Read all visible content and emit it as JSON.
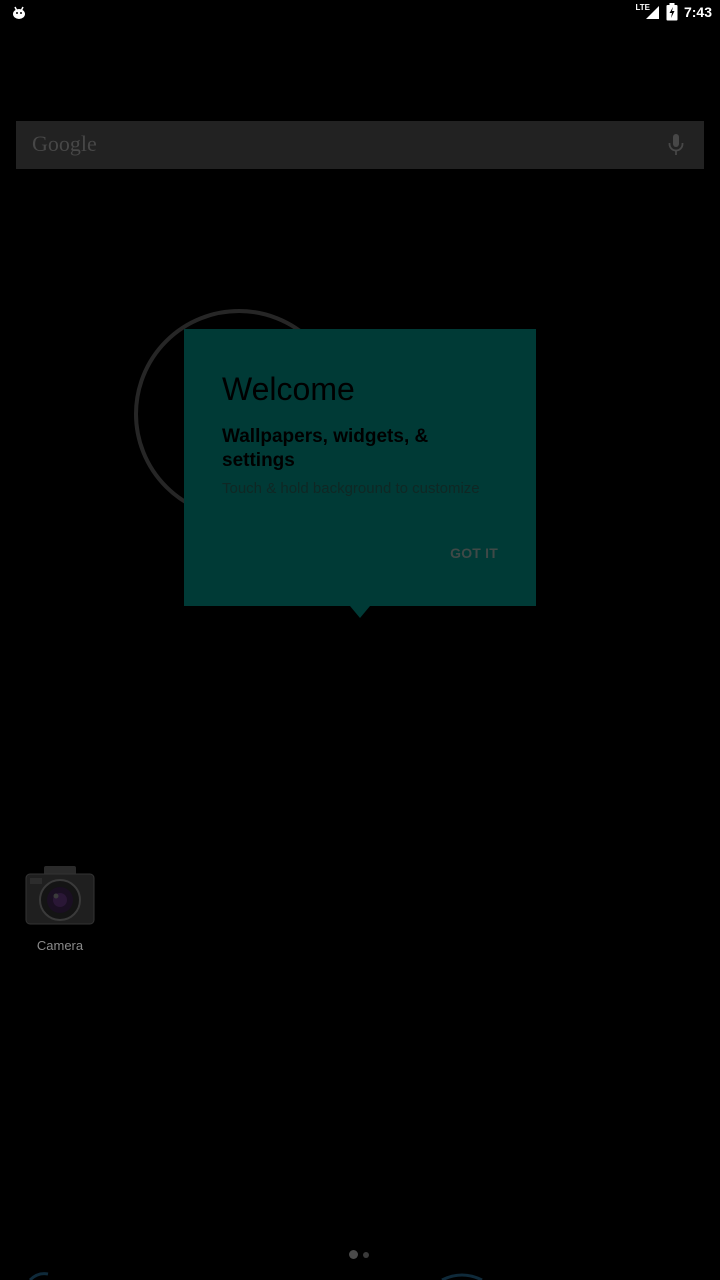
{
  "status_bar": {
    "network_label": "LTE",
    "time": "7:43",
    "left_icon": "android-debug-icon",
    "signal_icon": "signal-icon",
    "battery_icon": "battery-charging-icon"
  },
  "search_bar": {
    "label": "Google",
    "mic_icon": "mic-icon"
  },
  "clock_widget": {
    "icon": "analog-clock-icon"
  },
  "welcome_dialog": {
    "title": "Welcome",
    "subtitle": "Wallpapers, widgets, & settings",
    "hint": "Touch & hold background to customize",
    "button_label": "GOT IT",
    "background_color": "#003a36"
  },
  "apps": [
    {
      "label": "Camera",
      "icon": "camera-icon"
    }
  ],
  "page_indicator": {
    "pages": 2,
    "current_page": 1
  }
}
